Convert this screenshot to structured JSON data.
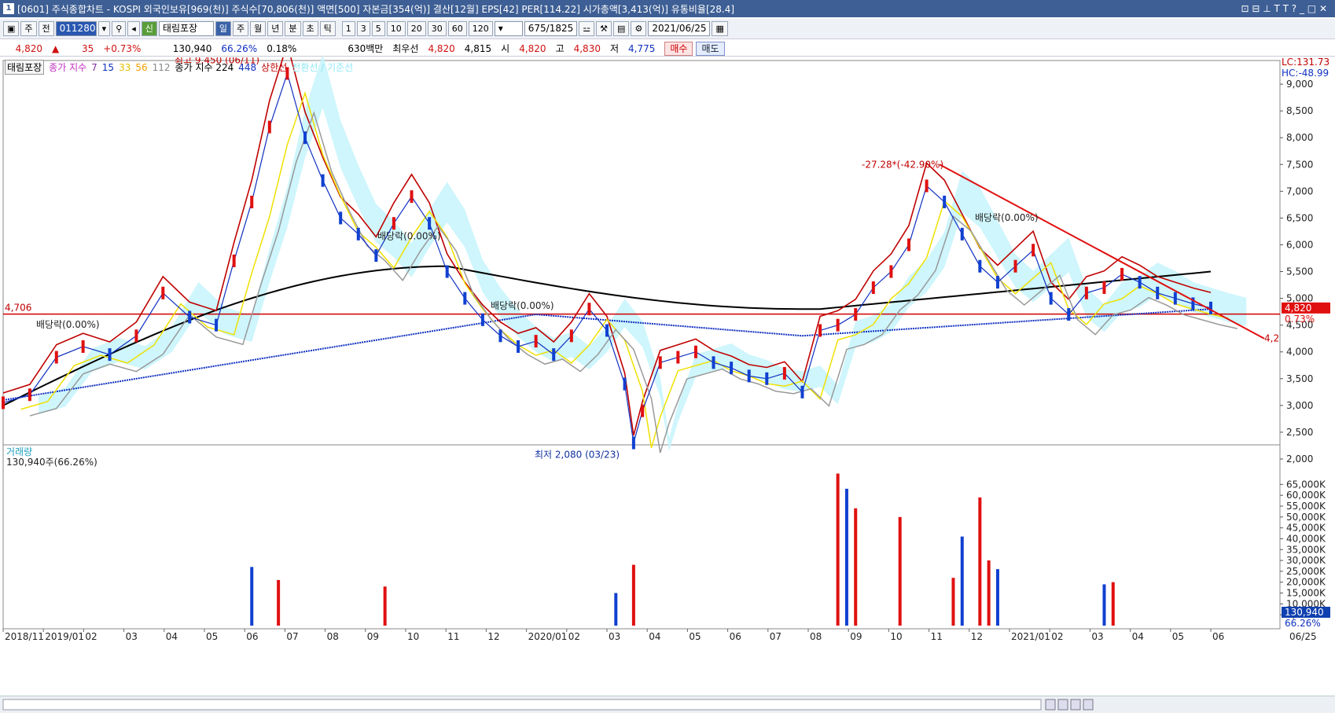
{
  "titlebar": {
    "num": "1",
    "title": "[0601] 주식종합차트 - KOSPI 외국인보유[969(천)] 주식수[70,806(천)] 액면[500] 자본금[354(억)] 결산[12월] EPS[42] PER[114.22] 시가총액[3,413(억)] 유통비율[28.4]",
    "icons": "⊡ ⊟ ⊥ T T ? _ □ ✕"
  },
  "toolbar": {
    "type": "주",
    "prev": "전",
    "code": "011280",
    "name": "태림포장",
    "new_badge": "신",
    "periods": [
      "일",
      "주",
      "월",
      "년",
      "분",
      "초",
      "틱"
    ],
    "active_period": "일",
    "intervals": [
      "1",
      "3",
      "5",
      "10",
      "20",
      "30",
      "60",
      "120"
    ],
    "count": "675/1825",
    "date": "2021/06/25"
  },
  "quote": {
    "price": "4,820",
    "arrow": "▲",
    "change": "35",
    "change_pct": "+0.73%",
    "volume": "130,940",
    "vol_ratio": "66.26%",
    "turnover": "0.18%",
    "amount": "630백만",
    "best_label": "최우선",
    "ask": "4,820",
    "bid": "4,815",
    "open_label": "시",
    "open": "4,820",
    "high_label": "고",
    "high": "4,830",
    "low_label": "저",
    "low": "4,775",
    "buy": "매수",
    "sell": "매도"
  },
  "legend": {
    "name": "태림포장",
    "ma_label": "종가 지수",
    "ma_values": [
      "7",
      "15",
      "33",
      "56",
      "112"
    ],
    "ma2_label": "종가 지수 224",
    "ma2_value": "448",
    "upper": "상한선",
    "faint": "전환선 / 기준선"
  },
  "chart_data": {
    "type": "candlestick",
    "price_axis": [
      "9,000",
      "8,500",
      "8,000",
      "7,500",
      "7,000",
      "6,500",
      "6,000",
      "5,500",
      "5,000",
      "4,500",
      "4,000",
      "3,500",
      "3,000",
      "2,500",
      "2,000"
    ],
    "ylim": [
      2000,
      9500
    ],
    "months": [
      "2018/11",
      "2019/01",
      "02",
      "03",
      "04",
      "05",
      "06",
      "07",
      "08",
      "09",
      "10",
      "11",
      "12",
      "2020/01",
      "02",
      "03",
      "04",
      "05",
      "06",
      "07",
      "08",
      "09",
      "10",
      "11",
      "12",
      "2021/01",
      "02",
      "03",
      "04",
      "05",
      "06"
    ],
    "price_series": [
      [
        0,
        3050
      ],
      [
        3,
        3200
      ],
      [
        6,
        3900
      ],
      [
        9,
        4100
      ],
      [
        12,
        3950
      ],
      [
        15,
        4300
      ],
      [
        18,
        5100
      ],
      [
        21,
        4650
      ],
      [
        24,
        4500
      ],
      [
        26,
        5700
      ],
      [
        28,
        6800
      ],
      [
        30,
        8200
      ],
      [
        32,
        9200
      ],
      [
        34,
        8000
      ],
      [
        36,
        7200
      ],
      [
        38,
        6500
      ],
      [
        40,
        6200
      ],
      [
        42,
        5800
      ],
      [
        44,
        6400
      ],
      [
        46,
        6900
      ],
      [
        48,
        6400
      ],
      [
        50,
        5500
      ],
      [
        52,
        5000
      ],
      [
        54,
        4600
      ],
      [
        56,
        4300
      ],
      [
        58,
        4100
      ],
      [
        60,
        4200
      ],
      [
        62,
        3950
      ],
      [
        64,
        4300
      ],
      [
        66,
        4800
      ],
      [
        68,
        4400
      ],
      [
        70,
        3400
      ],
      [
        71,
        2300
      ],
      [
        72,
        2900
      ],
      [
        74,
        3800
      ],
      [
        76,
        3900
      ],
      [
        78,
        4000
      ],
      [
        80,
        3800
      ],
      [
        82,
        3700
      ],
      [
        84,
        3550
      ],
      [
        86,
        3500
      ],
      [
        88,
        3600
      ],
      [
        90,
        3250
      ],
      [
        92,
        4400
      ],
      [
        94,
        4500
      ],
      [
        96,
        4700
      ],
      [
        98,
        5200
      ],
      [
        100,
        5500
      ],
      [
        102,
        6000
      ],
      [
        104,
        7100
      ],
      [
        106,
        6800
      ],
      [
        108,
        6200
      ],
      [
        110,
        5600
      ],
      [
        112,
        5300
      ],
      [
        114,
        5600
      ],
      [
        116,
        5900
      ],
      [
        118,
        5000
      ],
      [
        120,
        4700
      ],
      [
        122,
        5100
      ],
      [
        124,
        5200
      ],
      [
        126,
        5450
      ],
      [
        128,
        5300
      ],
      [
        130,
        5100
      ],
      [
        132,
        5000
      ],
      [
        134,
        4900
      ],
      [
        136,
        4820
      ]
    ],
    "min_label": "최저 2,080 (03/23)",
    "max_label": "최고 9,450 (06/11)",
    "trend_label": "-27.28*(-42.90%)",
    "trend_right": "4,2",
    "dividends": [
      "배당락(0.00%)",
      "배당락(0.00%)",
      "배당락(0.00%)",
      "배당락(0.00%)"
    ],
    "hline_label": "4,706",
    "lc": "LC:131.73",
    "hc": "HC:-48.99",
    "last_price": "4,820",
    "last_pct": "0.73%",
    "volume_panel": {
      "label": "거래량",
      "last": "130,940주(66.26%)",
      "axis": [
        "65,000K",
        "60,000K",
        "55,000K",
        "50,000K",
        "45,000K",
        "40,000K",
        "35,000K",
        "30,000K",
        "25,000K",
        "20,000K",
        "15,000K",
        "10,000K",
        "5,000K"
      ],
      "last_tag": "130,940",
      "last_tag_pct": "66.26%",
      "date_tag": "06/25",
      "spikes": [
        [
          28,
          27000
        ],
        [
          31,
          21000
        ],
        [
          43,
          18000
        ],
        [
          69,
          15000
        ],
        [
          71,
          28000
        ],
        [
          94,
          70000
        ],
        [
          95,
          63000
        ],
        [
          96,
          54000
        ],
        [
          101,
          50000
        ],
        [
          108,
          41000
        ],
        [
          110,
          59000
        ],
        [
          111,
          30000
        ],
        [
          124,
          19000
        ],
        [
          125,
          20000
        ],
        [
          107,
          22000
        ],
        [
          112,
          26000
        ]
      ]
    }
  }
}
